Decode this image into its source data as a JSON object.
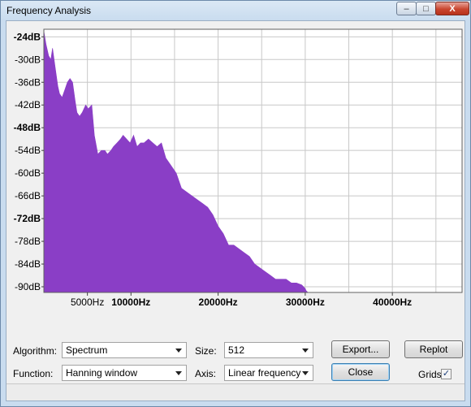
{
  "window": {
    "title": "Frequency Analysis",
    "buttons": {
      "minimize": "–",
      "maximize": "□",
      "close": "X"
    }
  },
  "chart_data": {
    "type": "area",
    "title": "",
    "xlabel": "",
    "ylabel": "",
    "color": "#8a3ec6",
    "grid": true,
    "xlim": [
      0,
      48000
    ],
    "ylim": [
      -91.5,
      -22
    ],
    "x_ticks": [
      {
        "value": 5000,
        "label": "5000Hz",
        "bold": false
      },
      {
        "value": 10000,
        "label": "10000Hz",
        "bold": true
      },
      {
        "value": 20000,
        "label": "20000Hz",
        "bold": true
      },
      {
        "value": 30000,
        "label": "30000Hz",
        "bold": true
      },
      {
        "value": 40000,
        "label": "40000Hz",
        "bold": true
      }
    ],
    "y_ticks": [
      {
        "value": -24,
        "label": "-24dB",
        "bold": true
      },
      {
        "value": -30,
        "label": "-30dB",
        "bold": false
      },
      {
        "value": -36,
        "label": "-36dB",
        "bold": false
      },
      {
        "value": -42,
        "label": "-42dB",
        "bold": false
      },
      {
        "value": -48,
        "label": "-48dB",
        "bold": true
      },
      {
        "value": -54,
        "label": "-54dB",
        "bold": false
      },
      {
        "value": -60,
        "label": "-60dB",
        "bold": false
      },
      {
        "value": -66,
        "label": "-66dB",
        "bold": false
      },
      {
        "value": -72,
        "label": "-72dB",
        "bold": true
      },
      {
        "value": -78,
        "label": "-78dB",
        "bold": false
      },
      {
        "value": -84,
        "label": "-84dB",
        "bold": false
      },
      {
        "value": -90,
        "label": "-90dB",
        "bold": false
      }
    ],
    "x": [
      0,
      250,
      550,
      800,
      1000,
      1300,
      1600,
      1800,
      2100,
      2400,
      2700,
      3000,
      3300,
      3600,
      3800,
      4100,
      4400,
      4800,
      5100,
      5500,
      5800,
      6200,
      6600,
      7000,
      7300,
      7700,
      8000,
      8400,
      8800,
      9100,
      9500,
      9900,
      10300,
      10700,
      11100,
      11500,
      12000,
      12500,
      13000,
      13500,
      14000,
      14600,
      15200,
      15800,
      16400,
      17000,
      17600,
      18200,
      18800,
      19400,
      20000,
      20600,
      21200,
      21800,
      22400,
      23000,
      23600,
      24200,
      24800,
      25400,
      26000,
      26600,
      27200,
      27800,
      28400,
      29000,
      29600,
      30000,
      30100,
      30300,
      30500,
      31000
    ],
    "y": [
      -22.5,
      -26,
      -29,
      -30,
      -27,
      -32,
      -37,
      -39,
      -40,
      -38,
      -36,
      -35,
      -36,
      -41,
      -44,
      -45,
      -44,
      -42,
      -43,
      -42,
      -50,
      -55,
      -54,
      -54,
      -55,
      -54,
      -53,
      -52,
      -51,
      -50,
      -51,
      -52,
      -50,
      -53,
      -52,
      -52,
      -51,
      -52,
      -53,
      -52,
      -56,
      -58,
      -60,
      -64,
      -65,
      -66,
      -67,
      -68,
      -69,
      -71,
      -74,
      -76,
      -79,
      -79,
      -80,
      -81,
      -82,
      -84,
      -85,
      -86,
      -87,
      -88,
      -88,
      -88,
      -89,
      -89,
      -89.5,
      -90.5,
      -91,
      -91.5,
      -91.5,
      -91.5
    ]
  },
  "controls": {
    "algorithm": {
      "label": "Algorithm:",
      "value": "Spectrum"
    },
    "size": {
      "label": "Size:",
      "value": "512"
    },
    "function": {
      "label": "Function:",
      "value": "Hanning window"
    },
    "axis": {
      "label": "Axis:",
      "value": "Linear frequency"
    },
    "export_label": "Export...",
    "replot_label": "Replot",
    "close_label": "Close",
    "grids": {
      "label": "Grids",
      "checked": true,
      "mark": "✓"
    }
  }
}
